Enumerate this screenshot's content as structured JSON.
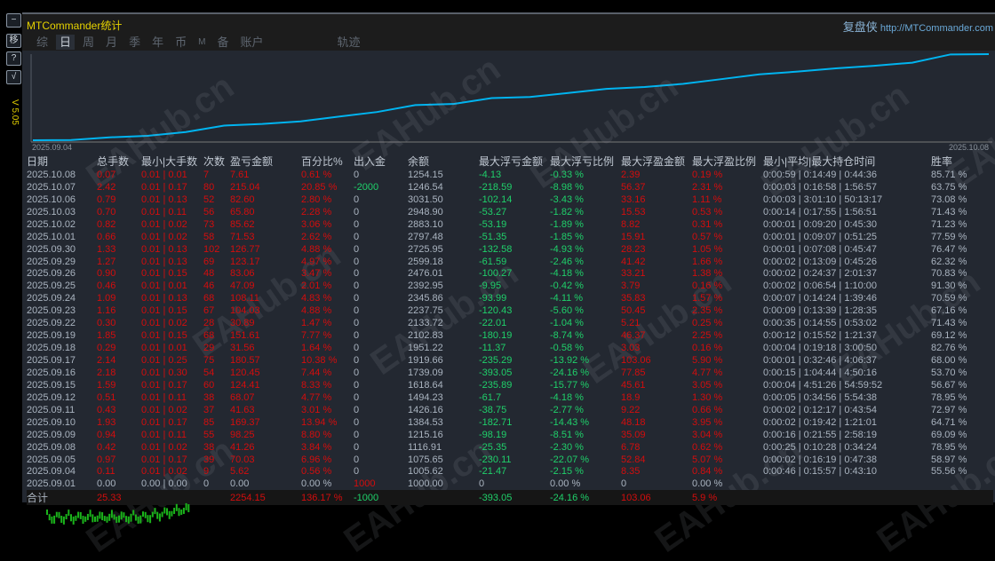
{
  "side_buttons": [
    "−",
    "移",
    "?",
    "√"
  ],
  "version": "V 5.05",
  "title": "MTCommander统计",
  "brand": {
    "name": "复盘侠",
    "url": "http://MTCommander.com"
  },
  "tabs": [
    {
      "label": "综"
    },
    {
      "label": "日",
      "active": true
    },
    {
      "label": "周"
    },
    {
      "label": "月"
    },
    {
      "label": "季"
    },
    {
      "label": "年"
    },
    {
      "label": "币"
    },
    {
      "label": "M"
    },
    {
      "label": "备"
    },
    {
      "label": "账户"
    },
    {
      "label": "轨迹"
    }
  ],
  "watermark": "EAHub.cn",
  "colors": {
    "line": "#00b4f0",
    "profit": "#d40d0d",
    "loss": "#1fd06a",
    "accent": "#e6d200"
  },
  "chart_data": {
    "type": "line",
    "x_start_label": "2025.09.04",
    "x_end_label": "2025.10.08",
    "series": "cumulative profit by day (from table)"
  },
  "headers": [
    "日期",
    "总手数",
    "最小|大手数",
    "次数",
    "盈亏金额",
    "百分比%",
    "出入金",
    "余额",
    "最大浮亏金额",
    "最大浮亏比例",
    "最大浮盈金额",
    "最大浮盈比例",
    "最小|平均|最大持仓时间",
    "胜率"
  ],
  "rows": [
    [
      "2025.10.08",
      "0.07",
      "0.01 | 0.01",
      "7",
      "7.61",
      "0.61 %",
      "0",
      "1254.15",
      "-4.13",
      "-0.33 %",
      "2.39",
      "0.19 %",
      "0:00:59 | 0:14:49 | 0:44:36",
      "85.71 %"
    ],
    [
      "2025.10.07",
      "2.42",
      "0.01 | 0.17",
      "80",
      "215.04",
      "20.85 %",
      "-2000",
      "1246.54",
      "-218.59",
      "-8.98 %",
      "56.37",
      "2.31 %",
      "0:00:03 | 0:16:58 | 1:56:57",
      "63.75 %"
    ],
    [
      "2025.10.06",
      "0.79",
      "0.01 | 0.13",
      "52",
      "82.60",
      "2.80 %",
      "0",
      "3031.50",
      "-102.14",
      "-3.43 %",
      "33.16",
      "1.11 %",
      "0:00:03 | 3:01:10 | 50:13:17",
      "73.08 %"
    ],
    [
      "2025.10.03",
      "0.70",
      "0.01 | 0.11",
      "56",
      "65.80",
      "2.28 %",
      "0",
      "2948.90",
      "-53.27",
      "-1.82 %",
      "15.53",
      "0.53 %",
      "0:00:14 | 0:17:55 | 1:56:51",
      "71.43 %"
    ],
    [
      "2025.10.02",
      "0.82",
      "0.01 | 0.02",
      "73",
      "85.62",
      "3.06 %",
      "0",
      "2883.10",
      "-53.19",
      "-1.89 %",
      "8.82",
      "0.31 %",
      "0:00:01 | 0:09:20 | 0:45:30",
      "71.23 %"
    ],
    [
      "2025.10.01",
      "0.66",
      "0.01 | 0.02",
      "58",
      "71.53",
      "2.62 %",
      "0",
      "2797.48",
      "-51.35",
      "-1.85 %",
      "15.91",
      "0.57 %",
      "0:00:01 | 0:09:07 | 0:51:25",
      "77.59 %"
    ],
    [
      "2025.09.30",
      "1.33",
      "0.01 | 0.13",
      "102",
      "126.77",
      "4.88 %",
      "0",
      "2725.95",
      "-132.58",
      "-4.93 %",
      "28.23",
      "1.05 %",
      "0:00:01 | 0:07:08 | 0:45:47",
      "76.47 %"
    ],
    [
      "2025.09.29",
      "1.27",
      "0.01 | 0.13",
      "69",
      "123.17",
      "4.97 %",
      "0",
      "2599.18",
      "-61.59",
      "-2.46 %",
      "41.42",
      "1.66 %",
      "0:00:02 | 0:13:09 | 0:45:26",
      "62.32 %"
    ],
    [
      "2025.09.26",
      "0.90",
      "0.01 | 0.15",
      "48",
      "83.06",
      "3.47 %",
      "0",
      "2476.01",
      "-100.27",
      "-4.18 %",
      "33.21",
      "1.38 %",
      "0:00:02 | 0:24:37 | 2:01:37",
      "70.83 %"
    ],
    [
      "2025.09.25",
      "0.46",
      "0.01 | 0.01",
      "46",
      "47.09",
      "2.01 %",
      "0",
      "2392.95",
      "-9.95",
      "-0.42 %",
      "3.79",
      "0.16 %",
      "0:00:02 | 0:06:54 | 1:10:00",
      "91.30 %"
    ],
    [
      "2025.09.24",
      "1.09",
      "0.01 | 0.13",
      "68",
      "108.11",
      "4.83 %",
      "0",
      "2345.86",
      "-93.99",
      "-4.11 %",
      "35.83",
      "1.57 %",
      "0:00:07 | 0:14:24 | 1:39:46",
      "70.59 %"
    ],
    [
      "2025.09.23",
      "1.16",
      "0.01 | 0.15",
      "67",
      "104.03",
      "4.88 %",
      "0",
      "2237.75",
      "-120.43",
      "-5.60 %",
      "50.45",
      "2.35 %",
      "0:00:09 | 0:13:39 | 1:28:35",
      "67.16 %"
    ],
    [
      "2025.09.22",
      "0.30",
      "0.01 | 0.02",
      "28",
      "30.89",
      "1.47 %",
      "0",
      "2133.72",
      "-22.01",
      "-1.04 %",
      "5.21",
      "0.25 %",
      "0:00:35 | 0:14:55 | 0:53:02",
      "71.43 %"
    ],
    [
      "2025.09.19",
      "1.85",
      "0.01 | 0.15",
      "68",
      "151.61",
      "7.77 %",
      "0",
      "2102.83",
      "-180.19",
      "-8.74 %",
      "46.37",
      "2.25 %",
      "0:00:12 | 0:15:52 | 1:21:37",
      "69.12 %"
    ],
    [
      "2025.09.18",
      "0.29",
      "0.01 | 0.01",
      "29",
      "31.56",
      "1.64 %",
      "0",
      "1951.22",
      "-11.37",
      "-0.58 %",
      "3.03",
      "0.16 %",
      "0:00:04 | 0:19:18 | 3:00:50",
      "82.76 %"
    ],
    [
      "2025.09.17",
      "2.14",
      "0.01 | 0.25",
      "75",
      "180.57",
      "10.38 %",
      "0",
      "1919.66",
      "-235.29",
      "-13.92 %",
      "103.06",
      "5.90 %",
      "0:00:01 | 0:32:46 | 4:06:37",
      "68.00 %"
    ],
    [
      "2025.09.16",
      "2.18",
      "0.01 | 0.30",
      "54",
      "120.45",
      "7.44 %",
      "0",
      "1739.09",
      "-393.05",
      "-24.16 %",
      "77.85",
      "4.77 %",
      "0:00:15 | 1:04:44 | 4:50:16",
      "53.70 %"
    ],
    [
      "2025.09.15",
      "1.59",
      "0.01 | 0.17",
      "60",
      "124.41",
      "8.33 %",
      "0",
      "1618.64",
      "-235.89",
      "-15.77 %",
      "45.61",
      "3.05 %",
      "0:00:04 | 4:51:26 | 54:59:52",
      "56.67 %"
    ],
    [
      "2025.09.12",
      "0.51",
      "0.01 | 0.11",
      "38",
      "68.07",
      "4.77 %",
      "0",
      "1494.23",
      "-61.7",
      "-4.18 %",
      "18.9",
      "1.30 %",
      "0:00:05 | 0:34:56 | 5:54:38",
      "78.95 %"
    ],
    [
      "2025.09.11",
      "0.43",
      "0.01 | 0.02",
      "37",
      "41.63",
      "3.01 %",
      "0",
      "1426.16",
      "-38.75",
      "-2.77 %",
      "9.22",
      "0.66 %",
      "0:00:02 | 0:12:17 | 0:43:54",
      "72.97 %"
    ],
    [
      "2025.09.10",
      "1.93",
      "0.01 | 0.17",
      "85",
      "169.37",
      "13.94 %",
      "0",
      "1384.53",
      "-182.71",
      "-14.43 %",
      "48.18",
      "3.95 %",
      "0:00:02 | 0:19:42 | 1:21:01",
      "64.71 %"
    ],
    [
      "2025.09.09",
      "0.94",
      "0.01 | 0.11",
      "55",
      "98.25",
      "8.80 %",
      "0",
      "1215.16",
      "-98.19",
      "-8.51 %",
      "35.09",
      "3.04 %",
      "0:00:16 | 0:21:55 | 2:58:19",
      "69.09 %"
    ],
    [
      "2025.09.08",
      "0.42",
      "0.01 | 0.02",
      "38",
      "41.26",
      "3.84 %",
      "0",
      "1116.91",
      "-25.35",
      "-2.30 %",
      "6.78",
      "0.62 %",
      "0:00:25 | 0:10:28 | 0:34:24",
      "78.95 %"
    ],
    [
      "2025.09.05",
      "0.97",
      "0.01 | 0.17",
      "39",
      "70.03",
      "6.96 %",
      "0",
      "1075.65",
      "-230.11",
      "-22.07 %",
      "52.84",
      "5.07 %",
      "0:00:02 | 0:16:19 | 0:47:38",
      "58.97 %"
    ],
    [
      "2025.09.04",
      "0.11",
      "0.01 | 0.02",
      "9",
      "5.62",
      "0.56 %",
      "0",
      "1005.62",
      "-21.47",
      "-2.15 %",
      "8.35",
      "0.84 %",
      "0:00:46 | 0:15:57 | 0:43:10",
      "55.56 %"
    ],
    [
      "2025.09.01",
      "0.00",
      "0.00 | 0.00",
      "0",
      "0.00",
      "0.00 %",
      "1000",
      "1000.00",
      "0",
      "0.00 %",
      "0",
      "0.00 %",
      "",
      ""
    ]
  ],
  "total": [
    "合计",
    "25.33",
    "",
    "",
    "2254.15",
    "136.17 %",
    "-1000",
    "",
    "-393.05",
    "-24.16 %",
    "103.06",
    "5.9 %",
    "",
    ""
  ]
}
